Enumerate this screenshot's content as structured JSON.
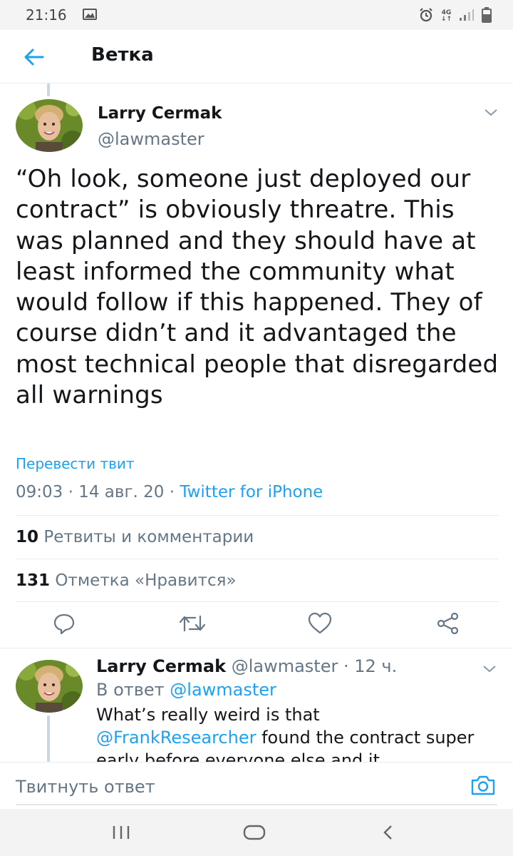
{
  "status_bar": {
    "time": "21:16",
    "network": "4G",
    "icons": [
      "image-icon",
      "alarm-icon",
      "signal-icon",
      "battery-icon"
    ]
  },
  "header": {
    "title": "Ветка",
    "back_icon": "arrow-left-icon"
  },
  "tweet": {
    "author_name": "Larry Cermak",
    "author_handle": "@lawmaster",
    "text": "“Oh look, someone just deployed our contract” is obviously threatre. This was planned and they should have at least informed the community what would follow if this happened. They of course didn’t and it advantaged the most technical people that disregarded all warnings",
    "translate_label": "Перевести твит",
    "time_date": "09:03 · 14 авг. 20 · ",
    "source": "Twitter for iPhone",
    "retweets_count": "10",
    "retweets_label": "Ретвиты и комментарии",
    "likes_count": "131",
    "likes_label": "Отметка «Нравится»",
    "actions": [
      "reply-icon",
      "retweet-icon",
      "like-icon",
      "share-icon"
    ]
  },
  "reply": {
    "author_name": "Larry Cermak",
    "meta": " @lawmaster · 12 ч.",
    "reply_prefix": "В ответ ",
    "reply_to": "@lawmaster",
    "text_line1": "What’s really weird is that",
    "mention": "@FrankResearcher",
    "text_rest": " found the contract super early before everyone else and it"
  },
  "composer": {
    "placeholder": "Твитнуть ответ",
    "camera_icon": "camera-icon"
  },
  "colors": {
    "accent": "#1da1f2",
    "text": "#14171a",
    "secondary": "#657786",
    "divider": "#e6ecf0"
  }
}
